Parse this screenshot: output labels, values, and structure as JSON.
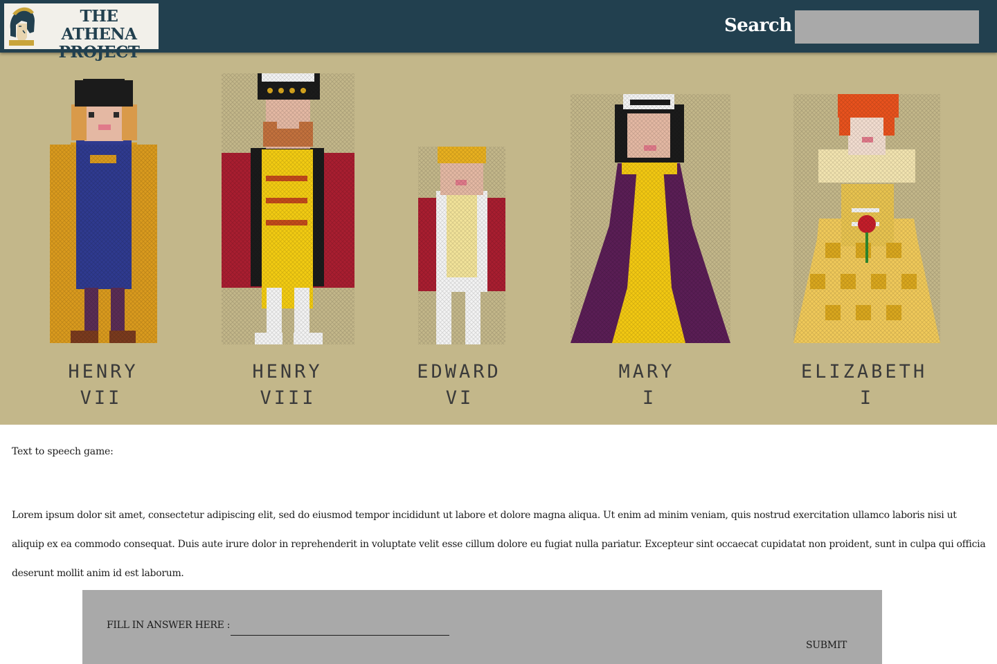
{
  "header": {
    "logo_line1": "THE ATHENA",
    "logo_line2": "PROJECT",
    "logo_icon": "athena-helmet-icon",
    "search_label": "Search",
    "search_value": "",
    "search_placeholder": ""
  },
  "hero": {
    "figures": [
      {
        "name": "HENRY",
        "numeral": "VII"
      },
      {
        "name": "HENRY",
        "numeral": "VIII"
      },
      {
        "name": "EDWARD",
        "numeral": "VI"
      },
      {
        "name": "MARY",
        "numeral": "I"
      },
      {
        "name": "ELIZABETH",
        "numeral": "I"
      }
    ]
  },
  "main": {
    "section_title": "Text to speech game:",
    "paragraph": "Lorem ipsum dolor sit amet, consectetur adipiscing elit, sed do eiusmod tempor incididunt ut labore et dolore magna aliqua. Ut enim ad minim veniam, quis nostrud exercitation ullamco laboris nisi ut aliquip ex ea commodo consequat. Duis aute irure dolor in reprehenderit in voluptate velit esse cillum dolore eu fugiat nulla pariatur. Excepteur sint occaecat cupidatat non proident, sunt in culpa qui officia deserunt mollit anim id est laborum."
  },
  "answer": {
    "label": "FILL IN ANSWER HERE :",
    "value": "",
    "submit_label": "SUBMIT"
  },
  "colors": {
    "header_bg": "#22404f",
    "hero_bg": "#c3b78a",
    "panel_gray": "#a9a9a9"
  }
}
